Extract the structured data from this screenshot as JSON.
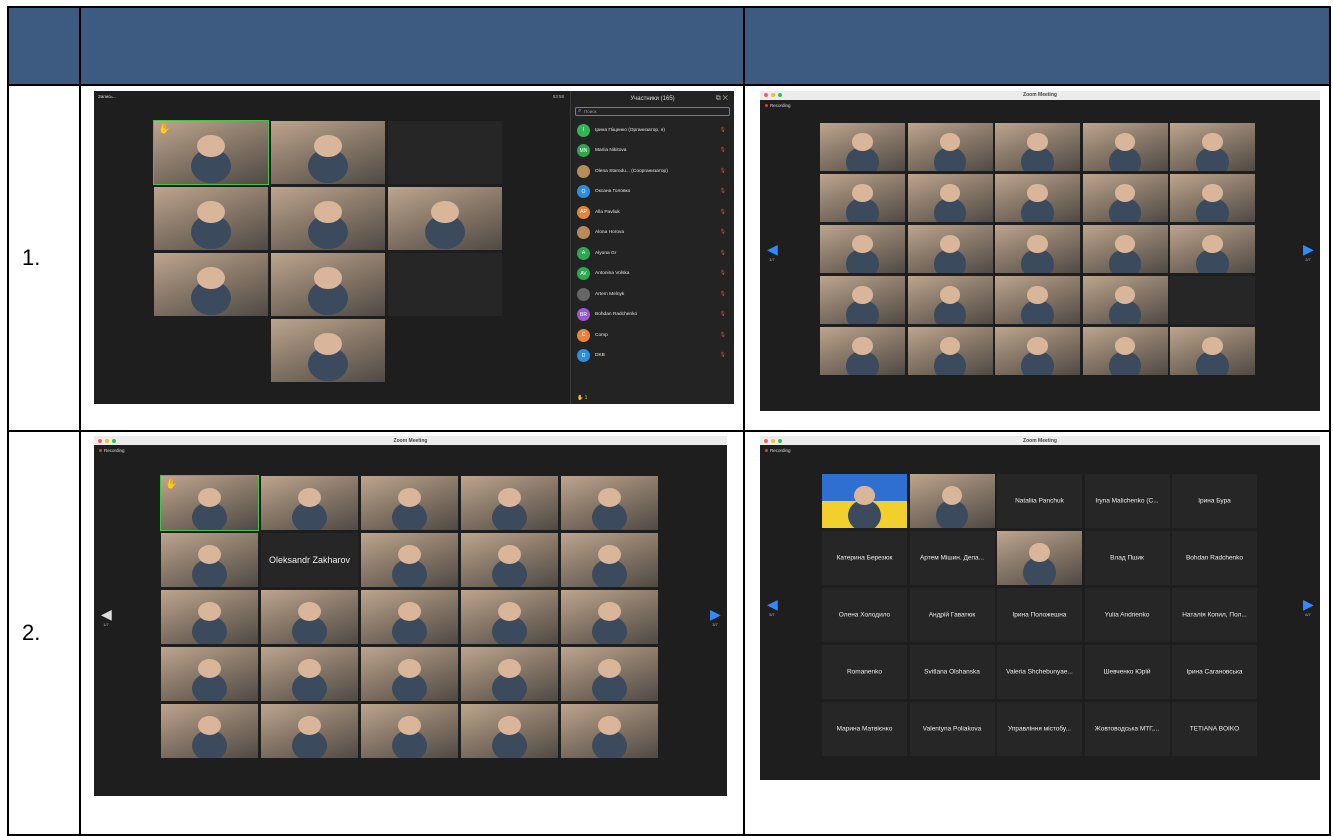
{
  "rows": [
    {
      "number": "1."
    },
    {
      "number": "2."
    }
  ],
  "shot_1a": {
    "top_left_label": "Запись...",
    "timer": "53:58",
    "panel_title": "Участники (165)",
    "search_placeholder": "Поиск",
    "participants": [
      {
        "initials": "І",
        "name": "Ірина Піщенко (Организатор, я)",
        "color": "#33b45a"
      },
      {
        "initials": "MN",
        "name": "Mariia Nikitova",
        "color": "#2ca84f"
      },
      {
        "initials": "",
        "name": "Olena Starodu... (Соорганизатор)",
        "color": "#b58c5a"
      },
      {
        "initials": "О",
        "name": "Оксана Головко",
        "color": "#2b8fe0"
      },
      {
        "initials": "AP",
        "name": "Alla Pavliuk",
        "color": "#e8833a"
      },
      {
        "initials": "",
        "name": "Alona Horova",
        "color": "#b58c5a"
      },
      {
        "initials": "A",
        "name": "Alyona Gr",
        "color": "#2ca84f"
      },
      {
        "initials": "AV",
        "name": "Antonina Volska",
        "color": "#2ca84f"
      },
      {
        "initials": "",
        "name": "Artem Melnyk",
        "color": "#666666"
      },
      {
        "initials": "BR",
        "name": "Bohdan Radchenko",
        "color": "#9b59d0"
      },
      {
        "initials": "C",
        "name": "Comp",
        "color": "#e8833a"
      },
      {
        "initials": "D",
        "name": "DKB",
        "color": "#2b8fe0"
      }
    ],
    "raise_count": "1"
  },
  "shot_1b": {
    "title": "Zoom Meeting",
    "recording": "Recording",
    "page_left": "1/7",
    "page_right": "2/7"
  },
  "shot_2a": {
    "title": "Zoom Meeting",
    "recording": "Recording",
    "named_tile": "Oleksandr Zakharov",
    "page_left": "1/7",
    "page_right": "3/7"
  },
  "shot_2b": {
    "title": "Zoom Meeting",
    "recording": "Recording",
    "page_left": "5/7",
    "page_right": "6/7",
    "names": [
      "",
      "",
      "Nataliia Panchuk",
      "Iryna Malichenko (C...",
      "Ірина Бура",
      "Катерина Березюк",
      "Артем Мішин. Депа...",
      "",
      "Влад Пшик",
      "Bohdan Radchenko",
      "Олена Холодило",
      "Андрій Гаватюк",
      "Ірина Положешна",
      "Yulia Andrienko",
      "Наталія Копил, Пол...",
      "Romanenko",
      "Svitlana Olshanska",
      "Valeria Shchebunyae...",
      "Шевченко Юрій",
      "Ірина Сагановська",
      "Марина Матвієнко",
      "Valentyna Poliakova",
      "Управління містобу...",
      "Жовтоводська МТГ,...",
      "TETIANA BOIKO"
    ]
  }
}
